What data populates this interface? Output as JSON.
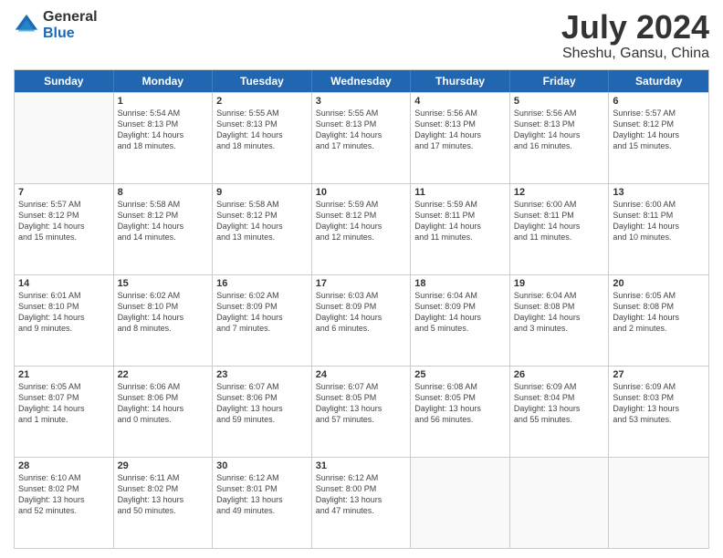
{
  "logo": {
    "general": "General",
    "blue": "Blue"
  },
  "title": "July 2024",
  "location": "Sheshu, Gansu, China",
  "headers": [
    "Sunday",
    "Monday",
    "Tuesday",
    "Wednesday",
    "Thursday",
    "Friday",
    "Saturday"
  ],
  "weeks": [
    [
      {
        "day": "",
        "info": ""
      },
      {
        "day": "1",
        "info": "Sunrise: 5:54 AM\nSunset: 8:13 PM\nDaylight: 14 hours\nand 18 minutes."
      },
      {
        "day": "2",
        "info": "Sunrise: 5:55 AM\nSunset: 8:13 PM\nDaylight: 14 hours\nand 18 minutes."
      },
      {
        "day": "3",
        "info": "Sunrise: 5:55 AM\nSunset: 8:13 PM\nDaylight: 14 hours\nand 17 minutes."
      },
      {
        "day": "4",
        "info": "Sunrise: 5:56 AM\nSunset: 8:13 PM\nDaylight: 14 hours\nand 17 minutes."
      },
      {
        "day": "5",
        "info": "Sunrise: 5:56 AM\nSunset: 8:13 PM\nDaylight: 14 hours\nand 16 minutes."
      },
      {
        "day": "6",
        "info": "Sunrise: 5:57 AM\nSunset: 8:12 PM\nDaylight: 14 hours\nand 15 minutes."
      }
    ],
    [
      {
        "day": "7",
        "info": "Sunrise: 5:57 AM\nSunset: 8:12 PM\nDaylight: 14 hours\nand 15 minutes."
      },
      {
        "day": "8",
        "info": "Sunrise: 5:58 AM\nSunset: 8:12 PM\nDaylight: 14 hours\nand 14 minutes."
      },
      {
        "day": "9",
        "info": "Sunrise: 5:58 AM\nSunset: 8:12 PM\nDaylight: 14 hours\nand 13 minutes."
      },
      {
        "day": "10",
        "info": "Sunrise: 5:59 AM\nSunset: 8:12 PM\nDaylight: 14 hours\nand 12 minutes."
      },
      {
        "day": "11",
        "info": "Sunrise: 5:59 AM\nSunset: 8:11 PM\nDaylight: 14 hours\nand 11 minutes."
      },
      {
        "day": "12",
        "info": "Sunrise: 6:00 AM\nSunset: 8:11 PM\nDaylight: 14 hours\nand 11 minutes."
      },
      {
        "day": "13",
        "info": "Sunrise: 6:00 AM\nSunset: 8:11 PM\nDaylight: 14 hours\nand 10 minutes."
      }
    ],
    [
      {
        "day": "14",
        "info": "Sunrise: 6:01 AM\nSunset: 8:10 PM\nDaylight: 14 hours\nand 9 minutes."
      },
      {
        "day": "15",
        "info": "Sunrise: 6:02 AM\nSunset: 8:10 PM\nDaylight: 14 hours\nand 8 minutes."
      },
      {
        "day": "16",
        "info": "Sunrise: 6:02 AM\nSunset: 8:09 PM\nDaylight: 14 hours\nand 7 minutes."
      },
      {
        "day": "17",
        "info": "Sunrise: 6:03 AM\nSunset: 8:09 PM\nDaylight: 14 hours\nand 6 minutes."
      },
      {
        "day": "18",
        "info": "Sunrise: 6:04 AM\nSunset: 8:09 PM\nDaylight: 14 hours\nand 5 minutes."
      },
      {
        "day": "19",
        "info": "Sunrise: 6:04 AM\nSunset: 8:08 PM\nDaylight: 14 hours\nand 3 minutes."
      },
      {
        "day": "20",
        "info": "Sunrise: 6:05 AM\nSunset: 8:08 PM\nDaylight: 14 hours\nand 2 minutes."
      }
    ],
    [
      {
        "day": "21",
        "info": "Sunrise: 6:05 AM\nSunset: 8:07 PM\nDaylight: 14 hours\nand 1 minute."
      },
      {
        "day": "22",
        "info": "Sunrise: 6:06 AM\nSunset: 8:06 PM\nDaylight: 14 hours\nand 0 minutes."
      },
      {
        "day": "23",
        "info": "Sunrise: 6:07 AM\nSunset: 8:06 PM\nDaylight: 13 hours\nand 59 minutes."
      },
      {
        "day": "24",
        "info": "Sunrise: 6:07 AM\nSunset: 8:05 PM\nDaylight: 13 hours\nand 57 minutes."
      },
      {
        "day": "25",
        "info": "Sunrise: 6:08 AM\nSunset: 8:05 PM\nDaylight: 13 hours\nand 56 minutes."
      },
      {
        "day": "26",
        "info": "Sunrise: 6:09 AM\nSunset: 8:04 PM\nDaylight: 13 hours\nand 55 minutes."
      },
      {
        "day": "27",
        "info": "Sunrise: 6:09 AM\nSunset: 8:03 PM\nDaylight: 13 hours\nand 53 minutes."
      }
    ],
    [
      {
        "day": "28",
        "info": "Sunrise: 6:10 AM\nSunset: 8:02 PM\nDaylight: 13 hours\nand 52 minutes."
      },
      {
        "day": "29",
        "info": "Sunrise: 6:11 AM\nSunset: 8:02 PM\nDaylight: 13 hours\nand 50 minutes."
      },
      {
        "day": "30",
        "info": "Sunrise: 6:12 AM\nSunset: 8:01 PM\nDaylight: 13 hours\nand 49 minutes."
      },
      {
        "day": "31",
        "info": "Sunrise: 6:12 AM\nSunset: 8:00 PM\nDaylight: 13 hours\nand 47 minutes."
      },
      {
        "day": "",
        "info": ""
      },
      {
        "day": "",
        "info": ""
      },
      {
        "day": "",
        "info": ""
      }
    ]
  ]
}
